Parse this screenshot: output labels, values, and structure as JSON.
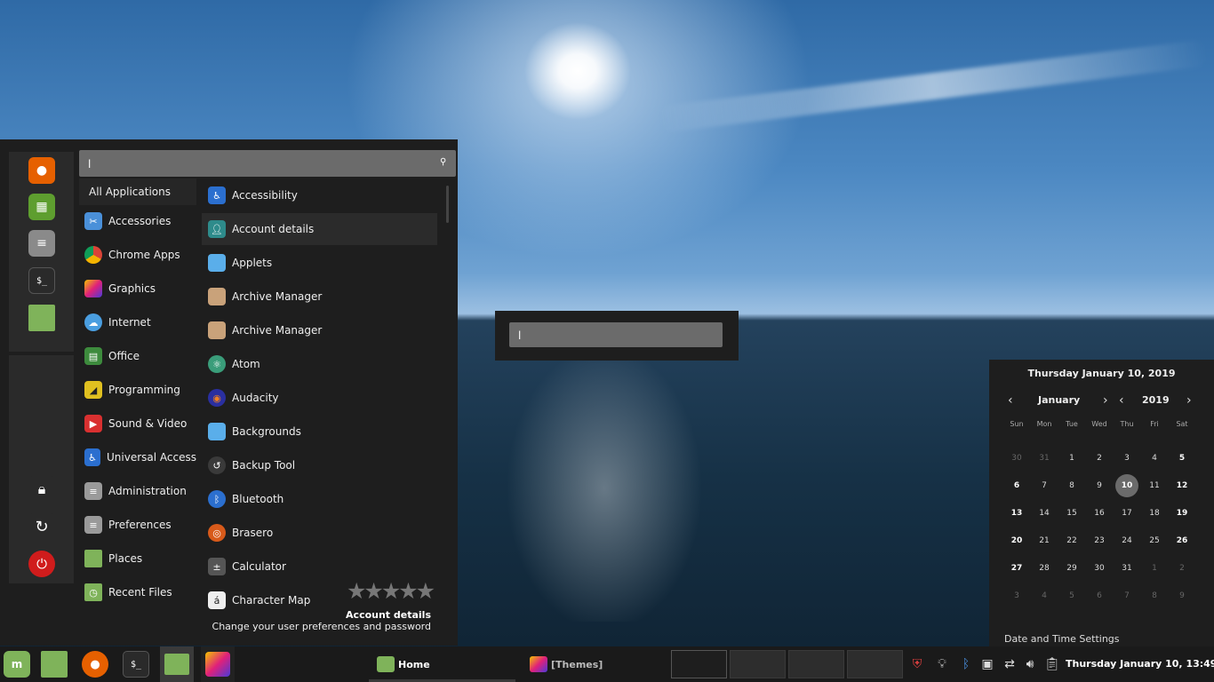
{
  "menu": {
    "search": {
      "value": "l",
      "icon": "search-icon"
    },
    "favorites": [
      {
        "name": "firefox",
        "color": "#e66000"
      },
      {
        "name": "software-manager",
        "color": "#5e9e2f"
      },
      {
        "name": "system-settings",
        "color": "#8a8a8a"
      },
      {
        "name": "terminal",
        "color": "#2a2a2a"
      },
      {
        "name": "files",
        "color": "#7fb35a"
      }
    ],
    "session": [
      {
        "name": "lock",
        "color": "#2a2a2a"
      },
      {
        "name": "logout",
        "color": "#2a2a2a"
      },
      {
        "name": "shutdown",
        "color": "#d01c1c"
      }
    ],
    "categories": [
      {
        "label": "All Applications",
        "color": ""
      },
      {
        "label": "Accessories",
        "color": "#4a90d9"
      },
      {
        "label": "Chrome Apps",
        "color": "#d9d9d9"
      },
      {
        "label": "Graphics",
        "color": "#c2399c"
      },
      {
        "label": "Internet",
        "color": "#4a9ee0"
      },
      {
        "label": "Office",
        "color": "#3d8b3d"
      },
      {
        "label": "Programming",
        "color": "#e0c020"
      },
      {
        "label": "Sound & Video",
        "color": "#d93030"
      },
      {
        "label": "Universal Access",
        "color": "#2b6fcf"
      },
      {
        "label": "Administration",
        "color": "#9a9a9a"
      },
      {
        "label": "Preferences",
        "color": "#9a9a9a"
      },
      {
        "label": "Places",
        "color": "#7fb35a"
      },
      {
        "label": "Recent Files",
        "color": "#7fb35a"
      }
    ],
    "apps": [
      {
        "label": "Accessibility",
        "color": "#2b6fcf"
      },
      {
        "label": "Account details",
        "color": "#2e8b8b"
      },
      {
        "label": "Applets",
        "color": "#5aaeea"
      },
      {
        "label": "Archive Manager",
        "color": "#c9a27a"
      },
      {
        "label": "Archive Manager",
        "color": "#c9a27a"
      },
      {
        "label": "Atom",
        "color": "#3a9d7a"
      },
      {
        "label": "Audacity",
        "color": "#2a2fa0"
      },
      {
        "label": "Backgrounds",
        "color": "#5aaeea"
      },
      {
        "label": "Backup Tool",
        "color": "#3a3a3a"
      },
      {
        "label": "Bluetooth",
        "color": "#2b6fcf"
      },
      {
        "label": "Brasero",
        "color": "#d85a1a"
      },
      {
        "label": "Calculator",
        "color": "#555555"
      },
      {
        "label": "Character Map",
        "color": "#eeeeee"
      }
    ],
    "description": {
      "title": "Account details",
      "text": "Change your user preferences and password"
    }
  },
  "run_dialog": {
    "value": "l"
  },
  "calendar": {
    "header": "Thursday January 10, 2019",
    "month": "January",
    "year": "2019",
    "weekdays": [
      "Sun",
      "Mon",
      "Tue",
      "Wed",
      "Thu",
      "Fri",
      "Sat"
    ],
    "weeks": [
      [
        "30",
        "31",
        "1",
        "2",
        "3",
        "4",
        "5"
      ],
      [
        "6",
        "7",
        "8",
        "9",
        "10",
        "11",
        "12"
      ],
      [
        "13",
        "14",
        "15",
        "16",
        "17",
        "18",
        "19"
      ],
      [
        "20",
        "21",
        "22",
        "23",
        "24",
        "25",
        "26"
      ],
      [
        "27",
        "28",
        "29",
        "30",
        "31",
        "1",
        "2"
      ],
      [
        "3",
        "4",
        "5",
        "6",
        "7",
        "8",
        "9"
      ]
    ],
    "today": "10",
    "settings_label": "Date and Time Settings"
  },
  "panel": {
    "launchers": [
      {
        "name": "mint-menu",
        "color": "#7fb35a"
      },
      {
        "name": "files",
        "color": "#7fb35a"
      },
      {
        "name": "firefox",
        "color": "#e66000"
      },
      {
        "name": "terminal",
        "color": "#2a2a2a"
      },
      {
        "name": "files-active",
        "color": "#7fb35a"
      },
      {
        "name": "themes",
        "color": "#c2399c"
      }
    ],
    "windows": [
      {
        "label": "Home",
        "color": "#7fb35a"
      },
      {
        "label": "[Themes]",
        "color": "#c2399c"
      }
    ],
    "clock": "Thursday January 10, 13:49"
  }
}
